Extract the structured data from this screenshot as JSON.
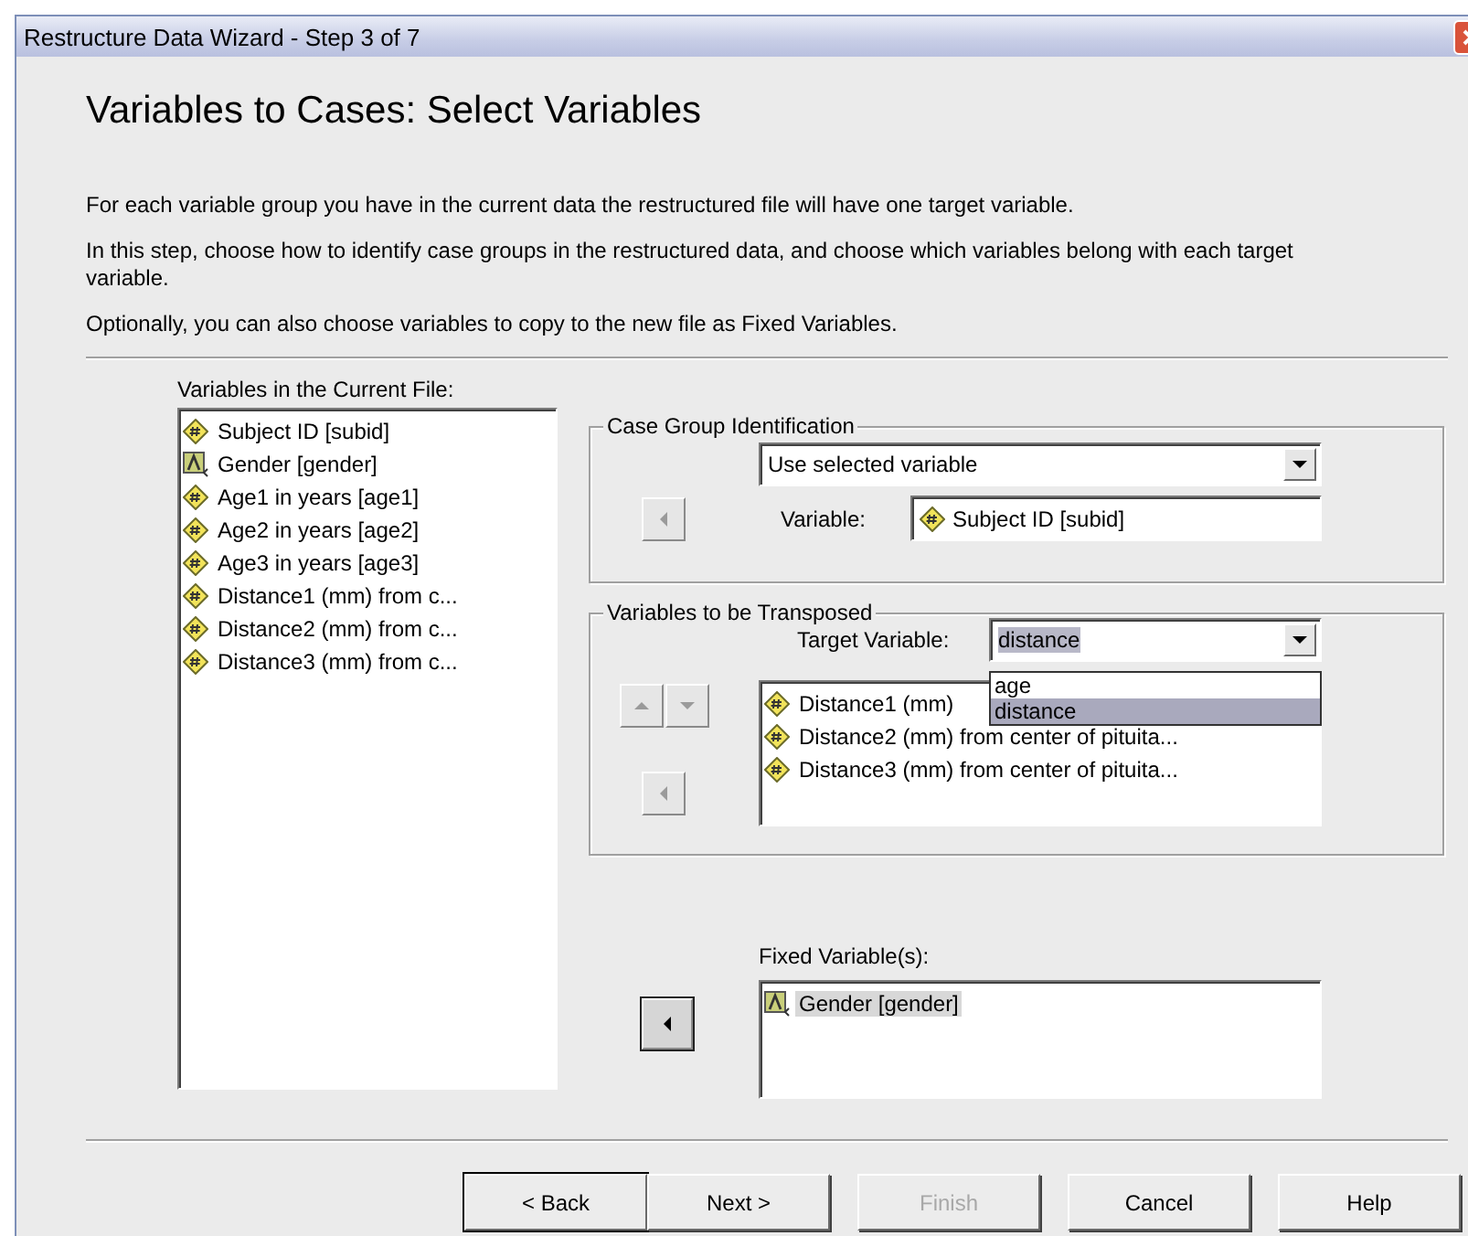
{
  "window": {
    "title": "Restructure Data Wizard - Step 3 of 7"
  },
  "heading": "Variables to Cases: Select Variables",
  "instructions": [
    "For each variable group you have in the current data the restructured file will have one target variable.",
    "In this step, choose how to identify case groups in the restructured data, and choose which variables belong with each target variable.",
    "Optionally, you can also choose variables to copy to the new file as Fixed Variables."
  ],
  "current_variables": {
    "label": "Variables in the Current File:",
    "items": [
      {
        "text": "Subject ID [subid]",
        "kind": "scale"
      },
      {
        "text": "Gender [gender]",
        "kind": "nominal"
      },
      {
        "text": "Age1 in years [age1]",
        "kind": "scale"
      },
      {
        "text": "Age2 in years [age2]",
        "kind": "scale"
      },
      {
        "text": "Age3 in years [age3]",
        "kind": "scale"
      },
      {
        "text": "Distance1 (mm) from c...",
        "kind": "scale"
      },
      {
        "text": "Distance2 (mm) from c...",
        "kind": "scale"
      },
      {
        "text": "Distance3 (mm) from c...",
        "kind": "scale"
      }
    ]
  },
  "case_group": {
    "title": "Case Group Identification",
    "method": "Use selected variable",
    "move_button": {
      "disabled": true
    },
    "variable_label": "Variable:",
    "variable": {
      "text": "Subject ID [subid]",
      "kind": "scale"
    }
  },
  "transposed": {
    "title": "Variables to be Transposed",
    "target_label": "Target Variable:",
    "target_value": "distance",
    "target_options": [
      {
        "label": "age",
        "selected": false
      },
      {
        "label": "distance",
        "selected": true
      }
    ],
    "order_buttons": {
      "disabled": true
    },
    "move_button": {
      "disabled": true
    },
    "items": [
      {
        "text": "Distance1 (mm)",
        "kind": "scale"
      },
      {
        "text": "Distance2 (mm) from center of pituita...",
        "kind": "scale"
      },
      {
        "text": "Distance3 (mm) from center of pituita...",
        "kind": "scale"
      }
    ]
  },
  "fixed": {
    "label": "Fixed Variable(s):",
    "move_button": {
      "disabled": false
    },
    "items": [
      {
        "text": "Gender [gender]",
        "kind": "nominal",
        "selected": true
      }
    ]
  },
  "buttons": [
    {
      "label": "< Back",
      "default": true,
      "disabled": false
    },
    {
      "label": "Next >",
      "default": false,
      "disabled": false
    },
    {
      "label": "Finish",
      "default": false,
      "disabled": true
    },
    {
      "label": "Cancel",
      "default": false,
      "disabled": false
    },
    {
      "label": "Help",
      "default": false,
      "disabled": false
    }
  ]
}
